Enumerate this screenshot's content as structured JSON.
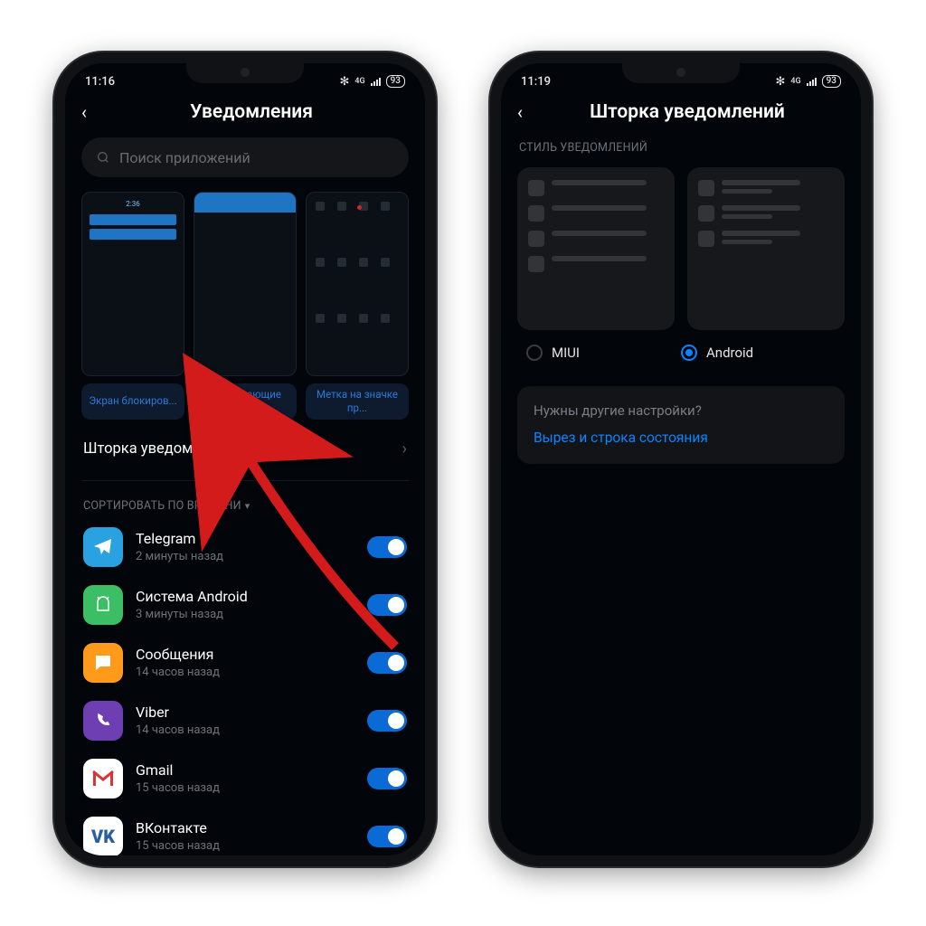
{
  "left": {
    "status_time": "11:16",
    "battery": "93",
    "title": "Уведомления",
    "search_placeholder": "Поиск приложений",
    "tiles": [
      {
        "label": "Экран блокиров..."
      },
      {
        "label": "Всплывающие увед..."
      },
      {
        "label": "Метка на значке пр..."
      }
    ],
    "shade_row": "Шторка уведомлений",
    "sort_label": "СОРТИРОВАТЬ ПО ВРЕМЕНИ",
    "preview_clock": "2:36",
    "apps": [
      {
        "name": "Telegram",
        "sub": "2 минуты назад",
        "icon": "tg"
      },
      {
        "name": "Система Android",
        "sub": "3 минуты назад",
        "icon": "and"
      },
      {
        "name": "Сообщения",
        "sub": "14 часов назад",
        "icon": "msg"
      },
      {
        "name": "Viber",
        "sub": "14 часов назад",
        "icon": "vb"
      },
      {
        "name": "Gmail",
        "sub": "15 часов назад",
        "icon": "gm"
      },
      {
        "name": "ВКонтакте",
        "sub": "15 часов назад",
        "icon": "vk"
      }
    ]
  },
  "right": {
    "status_time": "11:19",
    "battery": "93",
    "title": "Шторка уведомлений",
    "style_label": "СТИЛЬ УВЕДОМЛЕНИЙ",
    "radio_miui": "MIUI",
    "radio_android": "Android",
    "card_question": "Нужны другие настройки?",
    "card_link": "Вырез и строка состояния"
  }
}
